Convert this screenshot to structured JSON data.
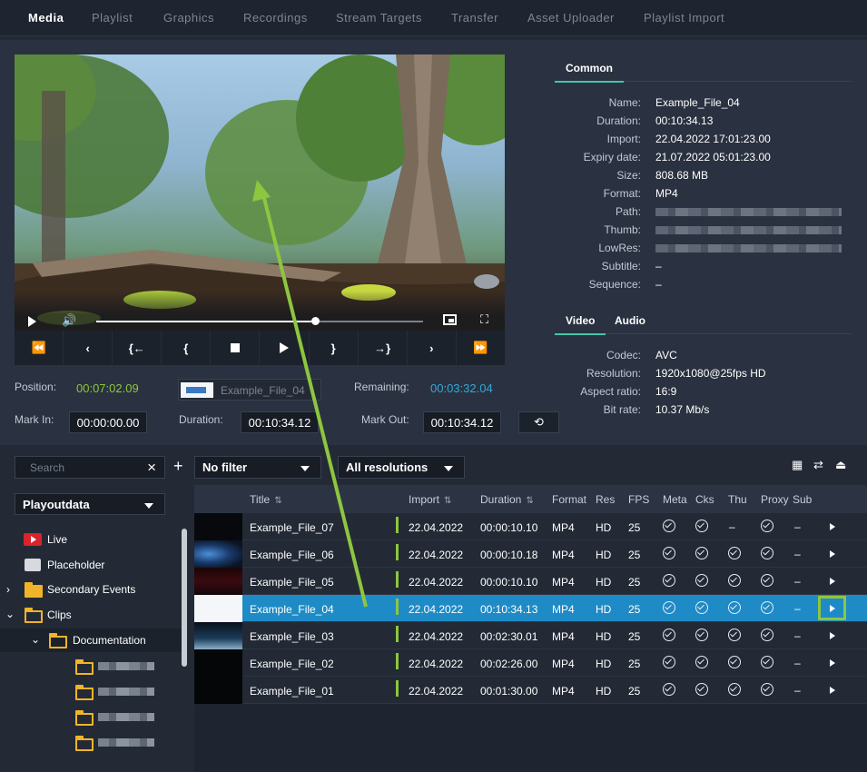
{
  "nav": {
    "tabs": [
      {
        "label": "Media"
      },
      {
        "label": "Playlist"
      },
      {
        "label": "Graphics"
      },
      {
        "label": "Recordings"
      },
      {
        "label": "Stream Targets"
      },
      {
        "label": "Transfer"
      },
      {
        "label": "Asset Uploader"
      },
      {
        "label": "Playlist Import"
      }
    ],
    "active": "Media"
  },
  "player": {
    "position_label": "Position:",
    "position": "00:07:02.09",
    "current_clip": "Example_File_04",
    "remaining_label": "Remaining:",
    "remaining": "00:03:32.04",
    "mark_in_label": "Mark In:",
    "mark_in": "00:00:00.00",
    "duration_label": "Duration:",
    "duration": "00:10:34.12",
    "mark_out_label": "Mark Out:",
    "mark_out": "00:10:34.12",
    "progress": 0.67,
    "transport": [
      "⏪",
      "‹",
      "{←",
      "{",
      "■",
      "▶",
      "}",
      "→}",
      "›",
      "⏩"
    ]
  },
  "info": {
    "common_tab": "Common",
    "video_tab": "Video",
    "audio_tab": "Audio",
    "common": [
      {
        "k": "Name:",
        "v": "Example_File_04"
      },
      {
        "k": "Duration:",
        "v": "00:10:34.13"
      },
      {
        "k": "Import:",
        "v": "22.04.2022 17:01:23.00"
      },
      {
        "k": "Expiry date:",
        "v": "21.07.2022 05:01:23.00"
      },
      {
        "k": "Size:",
        "v": "808.68 MB"
      },
      {
        "k": "Format:",
        "v": "MP4"
      },
      {
        "k": "Path:",
        "v": ""
      },
      {
        "k": "Thumb:",
        "v": ""
      },
      {
        "k": "LowRes:",
        "v": ""
      },
      {
        "k": "Subtitle:",
        "v": "–"
      },
      {
        "k": "Sequence:",
        "v": "–"
      }
    ],
    "video": [
      {
        "k": "Codec:",
        "v": "AVC"
      },
      {
        "k": "Resolution:",
        "v": "1920x1080@25fps   HD"
      },
      {
        "k": "Aspect ratio:",
        "v": "16:9"
      },
      {
        "k": "Bit rate:",
        "v": "10.37 Mb/s"
      }
    ]
  },
  "toolbar": {
    "search_placeholder": "Search",
    "filter": "No filter",
    "resolution": "All resolutions"
  },
  "tree": {
    "root": "Playoutdata",
    "items": [
      "Live",
      "Placeholder",
      "Secondary Events",
      "Clips",
      "Documentation"
    ]
  },
  "table": {
    "headers": [
      "Title",
      "Import",
      "Duration",
      "Format",
      "Res",
      "FPS",
      "Meta",
      "Cks",
      "Thu",
      "Proxy",
      "Sub"
    ],
    "rows": [
      {
        "title": "Example_File_07",
        "import": "22.04.2022",
        "duration": "00:00:10.10",
        "format": "MP4",
        "res": "HD",
        "fps": "25",
        "thu": "–",
        "sub": "–"
      },
      {
        "title": "Example_File_06",
        "import": "22.04.2022",
        "duration": "00:00:10.18",
        "format": "MP4",
        "res": "HD",
        "fps": "25",
        "thu": "check",
        "sub": "–"
      },
      {
        "title": "Example_File_05",
        "import": "22.04.2022",
        "duration": "00:00:10.10",
        "format": "MP4",
        "res": "HD",
        "fps": "25",
        "thu": "check",
        "sub": "–"
      },
      {
        "title": "Example_File_04",
        "import": "22.04.2022",
        "duration": "00:10:34.13",
        "format": "MP4",
        "res": "HD",
        "fps": "25",
        "thu": "check",
        "sub": "–"
      },
      {
        "title": "Example_File_03",
        "import": "22.04.2022",
        "duration": "00:02:30.01",
        "format": "MP4",
        "res": "HD",
        "fps": "25",
        "thu": "check",
        "sub": "–"
      },
      {
        "title": "Example_File_02",
        "import": "22.04.2022",
        "duration": "00:02:26.00",
        "format": "MP4",
        "res": "HD",
        "fps": "25",
        "thu": "check",
        "sub": "–"
      },
      {
        "title": "Example_File_01",
        "import": "22.04.2022",
        "duration": "00:01:30.00",
        "format": "MP4",
        "res": "HD",
        "fps": "25",
        "thu": "check",
        "sub": "–"
      }
    ]
  },
  "colors": {
    "accent_green": "#8dc63f",
    "accent_blue": "#35a9d9",
    "selected_row": "#1e8bc6",
    "tab_underline": "#41c7a8"
  }
}
